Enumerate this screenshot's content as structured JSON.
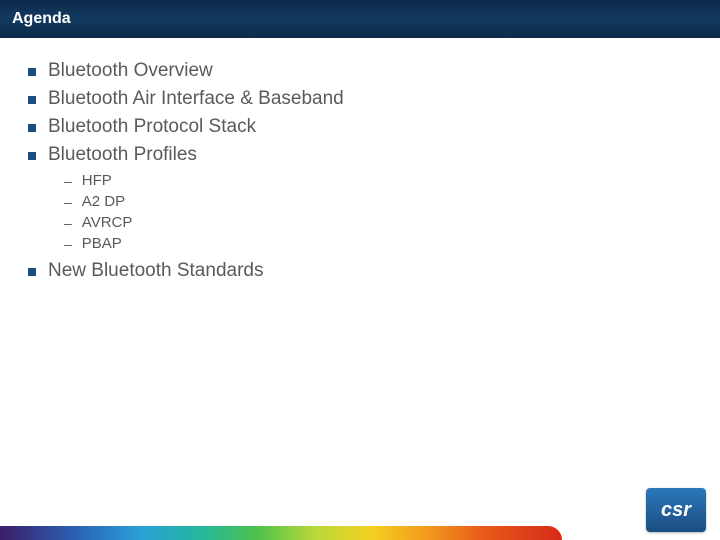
{
  "header": {
    "title": "Agenda"
  },
  "bullets": {
    "items": [
      {
        "text": "Bluetooth Overview",
        "sub": null
      },
      {
        "text": "Bluetooth Air Interface & Baseband",
        "sub": null
      },
      {
        "text": "Bluetooth Protocol Stack",
        "sub": null
      },
      {
        "text": "Bluetooth Profiles",
        "sub": [
          {
            "text": "HFP"
          },
          {
            "text": "A2 DP"
          },
          {
            "text": "AVRCP"
          },
          {
            "text": "PBAP"
          }
        ]
      },
      {
        "text": "New Bluetooth Standards",
        "sub": null
      }
    ]
  },
  "footer": {
    "logo_text": "csr"
  }
}
